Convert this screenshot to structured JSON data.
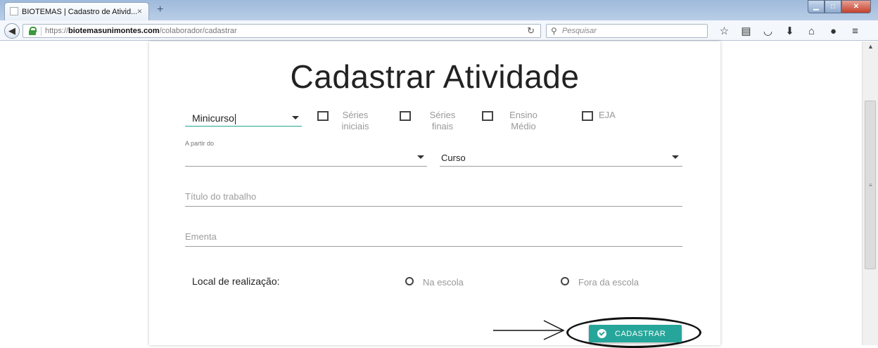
{
  "browser": {
    "tab_title": "BIOTEMAS | Cadastro de Ativid...",
    "tab_close_glyph": "×",
    "new_tab_glyph": "+",
    "url_prefix": "https://",
    "url_domain": "biotemasunimontes.com",
    "url_path": "/colaborador/cadastrar",
    "search_placeholder": "Pesquisar",
    "toolbar_icons": [
      "star-icon",
      "reading-list-icon",
      "pocket-icon",
      "download-icon",
      "home-icon",
      "chat-icon",
      "menu-icon"
    ]
  },
  "form": {
    "title": "Cadastrar Atividade",
    "modality_value": "Minicurso",
    "checkboxes": [
      {
        "line1": "Séries",
        "line2": "iniciais"
      },
      {
        "line1": "Séries",
        "line2": "finais"
      },
      {
        "line1": "Ensino",
        "line2": "Médio"
      },
      {
        "line1": "EJA",
        "line2": ""
      }
    ],
    "apartir_label": "A partir do",
    "apartir_value": "",
    "curso_value": "Curso",
    "titulo_placeholder": "Título do trabalho",
    "ementa_placeholder": "Ementa",
    "local_label": "Local de realização:",
    "radio_options": [
      "Na escola",
      "Fora da escola"
    ],
    "submit_label": "CADASTRAR"
  },
  "colors": {
    "accent": "#26a69a",
    "annotation": "#111111"
  }
}
